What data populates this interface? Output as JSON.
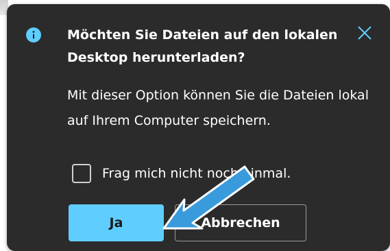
{
  "dialog": {
    "title": "Möchten Sie Dateien auf den lokalen Desktop herunterladen?",
    "message": "Mit dieser Option können Sie die Dateien lokal auf Ihrem Computer speichern.",
    "checkbox": {
      "label": "Frag mich nicht noch einmal.",
      "checked": false
    },
    "buttons": {
      "confirm_label": "Ja",
      "cancel_label": "Abbrechen"
    },
    "icons": {
      "info": "info-icon",
      "close": "close-icon"
    },
    "colors": {
      "background": "#2b2b2b",
      "accent": "#60cdff",
      "text": "#ffffff",
      "annotation_arrow": "#3a9bdc"
    }
  }
}
